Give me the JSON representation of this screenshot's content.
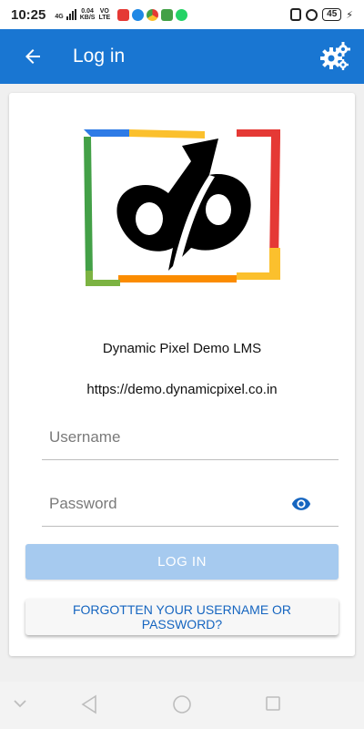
{
  "status_bar": {
    "time": "10:25",
    "net_top": "4G",
    "speed_value": "0.04",
    "speed_unit": "KB/S",
    "volte_top": "VO",
    "volte_bottom": "LTE",
    "battery": "45"
  },
  "app_bar": {
    "title": "Log in",
    "back_icon": "arrow-back-icon",
    "settings_icon": "gears-icon",
    "background": "#1976d2"
  },
  "site": {
    "name": "Dynamic Pixel Demo LMS",
    "url": "https://demo.dynamicpixel.co.in",
    "logo_text": "dp"
  },
  "form": {
    "username_placeholder": "Username",
    "username_value": "",
    "password_placeholder": "Password",
    "password_value": "",
    "login_label": "LOG IN",
    "forgot_label": "FORGOTTEN YOUR USERNAME OR PASSWORD?"
  },
  "colors": {
    "accent": "#1976d2",
    "login_disabled": "#a6caef",
    "link": "#1565c0"
  },
  "nav": {
    "icons": [
      "chevron-down-icon",
      "back-triangle-icon",
      "home-circle-icon",
      "recents-square-icon"
    ]
  }
}
